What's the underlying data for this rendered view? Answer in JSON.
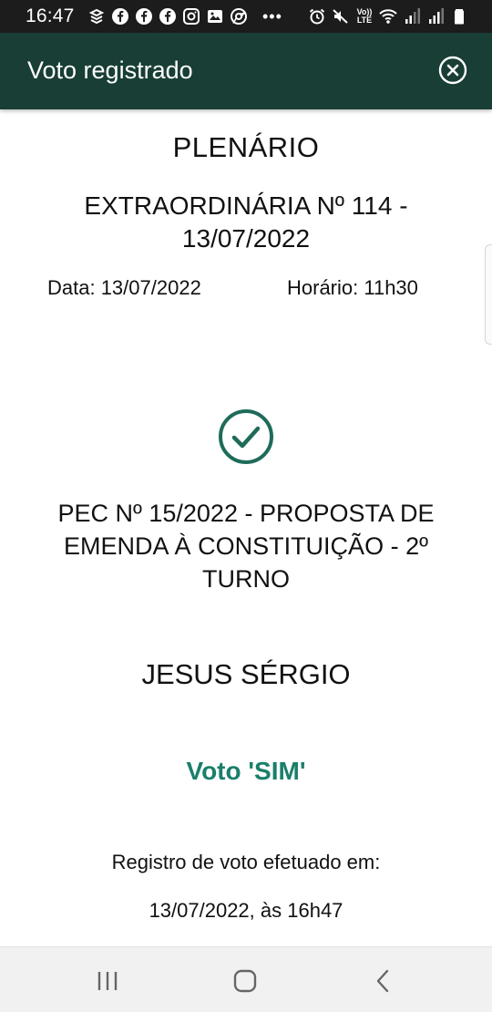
{
  "status_bar": {
    "time": "16:47",
    "lte_label": "Vo)) LTE"
  },
  "header": {
    "title": "Voto registrado"
  },
  "session": {
    "type": "PLENÁRIO",
    "name": "EXTRAORDINÁRIA Nº 114 - 13/07/2022",
    "date": "Data: 13/07/2022",
    "time": "Horário: 11h30"
  },
  "proposition": "PEC Nº 15/2022 - PROPOSTA DE EMENDA À CONSTITUIÇÃO - 2º TURNO",
  "deputy": "JESUS SÉRGIO",
  "vote": "Voto 'SIM'",
  "register": {
    "label": "Registro de voto efetuado em:",
    "datetime": "13/07/2022, às 16h47"
  },
  "colors": {
    "header_bg": "#183e35",
    "vote_green": "#1a7f6a",
    "check_green": "#1f6b5a"
  }
}
